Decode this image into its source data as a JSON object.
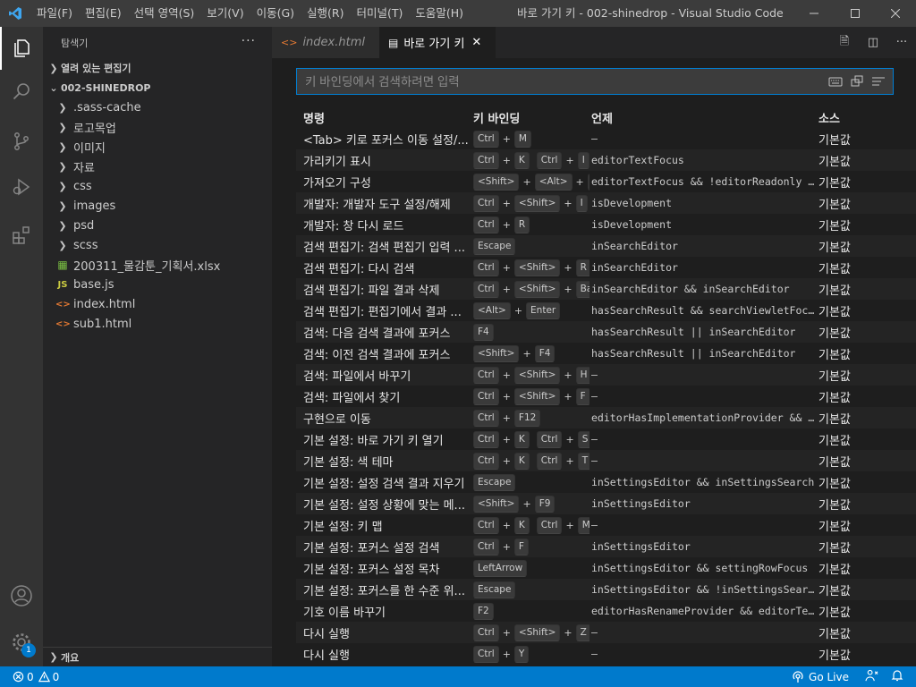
{
  "titlebar": {
    "menu": [
      "파일(F)",
      "편집(E)",
      "선택 영역(S)",
      "보기(V)",
      "이동(G)",
      "실행(R)",
      "터미널(T)",
      "도움말(H)"
    ],
    "window_title": "바로 가기 키 - 002-shinedrop - Visual Studio Code [관리..."
  },
  "colors": {
    "accent": "#007acc",
    "titlebar": "#3c3c3c",
    "sidebar": "#252526",
    "editor": "#1e1e1e"
  },
  "activitybar": {
    "settings_badge": "1"
  },
  "sidebar": {
    "title": "탐색기",
    "open_editors": "열려 있는 편집기",
    "folder": "002-SHINEDROP",
    "items": [
      {
        "label": ".sass-cache",
        "type": "folder"
      },
      {
        "label": "로고목업",
        "type": "folder"
      },
      {
        "label": "이미지",
        "type": "folder"
      },
      {
        "label": "자료",
        "type": "folder"
      },
      {
        "label": "css",
        "type": "folder"
      },
      {
        "label": "images",
        "type": "folder"
      },
      {
        "label": "psd",
        "type": "folder"
      },
      {
        "label": "scss",
        "type": "folder"
      },
      {
        "label": "200311_물감툰_기획서.xlsx",
        "type": "xlsx"
      },
      {
        "label": "base.js",
        "type": "js"
      },
      {
        "label": "index.html",
        "type": "html"
      },
      {
        "label": "sub1.html",
        "type": "html"
      }
    ],
    "outline": "개요"
  },
  "tabs": [
    {
      "label": "index.html",
      "active": false
    },
    {
      "label": "바로 가기 키",
      "active": true
    }
  ],
  "search": {
    "placeholder": "키 바인딩에서 검색하려면 입력"
  },
  "table": {
    "headers": {
      "command": "명령",
      "keybinding": "키 바인딩",
      "when": "언제",
      "source": "소스"
    },
    "rows": [
      {
        "command": "<Tab> 키로 포커스 이동 설정/...",
        "keys": [
          [
            "Ctrl",
            "M"
          ]
        ],
        "when": "—",
        "source": "기본값"
      },
      {
        "command": "가리키기 표시",
        "keys": [
          [
            "Ctrl",
            "K"
          ],
          [
            "Ctrl",
            "I"
          ]
        ],
        "when": "editorTextFocus",
        "source": "기본값"
      },
      {
        "command": "가져오기 구성",
        "keys": [
          [
            "<Shift>",
            "<Alt>",
            "O"
          ]
        ],
        "when": "editorTextFocus && !editorReadonly && ...",
        "source": "기본값"
      },
      {
        "command": "개발자: 개발자 도구 설정/해제",
        "keys": [
          [
            "Ctrl",
            "<Shift>",
            "I"
          ]
        ],
        "when": "isDevelopment",
        "source": "기본값"
      },
      {
        "command": "개발자: 창 다시 로드",
        "keys": [
          [
            "Ctrl",
            "R"
          ]
        ],
        "when": "isDevelopment",
        "source": "기본값"
      },
      {
        "command": "검색 편집기: 검색 편집기 입력 ...",
        "keys": [
          [
            "Escape"
          ]
        ],
        "when": "inSearchEditor",
        "source": "기본값"
      },
      {
        "command": "검색 편집기: 다시 검색",
        "keys": [
          [
            "Ctrl",
            "<Shift>",
            "R"
          ]
        ],
        "when": "inSearchEditor",
        "source": "기본값"
      },
      {
        "command": "검색 편집기: 파일 결과 삭제",
        "keys": [
          [
            "Ctrl",
            "<Shift>",
            "Backspace"
          ]
        ],
        "when": "inSearchEditor && inSearchEditor",
        "source": "기본값"
      },
      {
        "command": "검색 편집기: 편집기에서 결과 ...",
        "keys": [
          [
            "<Alt>",
            "Enter"
          ]
        ],
        "when": "hasSearchResult && searchViewletFocus",
        "source": "기본값"
      },
      {
        "command": "검색: 다음 검색 결과에 포커스",
        "keys": [
          [
            "F4"
          ]
        ],
        "when": "hasSearchResult || inSearchEditor",
        "source": "기본값"
      },
      {
        "command": "검색: 이전 검색 결과에 포커스",
        "keys": [
          [
            "<Shift>",
            "F4"
          ]
        ],
        "when": "hasSearchResult || inSearchEditor",
        "source": "기본값"
      },
      {
        "command": "검색: 파일에서 바꾸기",
        "keys": [
          [
            "Ctrl",
            "<Shift>",
            "H"
          ]
        ],
        "when": "—",
        "source": "기본값"
      },
      {
        "command": "검색: 파일에서 찾기",
        "keys": [
          [
            "Ctrl",
            "<Shift>",
            "F"
          ]
        ],
        "when": "—",
        "source": "기본값"
      },
      {
        "command": "구현으로 이동",
        "keys": [
          [
            "Ctrl",
            "F12"
          ]
        ],
        "when": "editorHasImplementationProvider && edi...",
        "source": "기본값"
      },
      {
        "command": "기본 설정: 바로 가기 키 열기",
        "keys": [
          [
            "Ctrl",
            "K"
          ],
          [
            "Ctrl",
            "S"
          ]
        ],
        "when": "—",
        "source": "기본값"
      },
      {
        "command": "기본 설정: 색 테마",
        "keys": [
          [
            "Ctrl",
            "K"
          ],
          [
            "Ctrl",
            "T"
          ]
        ],
        "when": "—",
        "source": "기본값"
      },
      {
        "command": "기본 설정: 설정 검색 결과 지우기",
        "keys": [
          [
            "Escape"
          ]
        ],
        "when": "inSettingsEditor && inSettingsSearch",
        "source": "기본값"
      },
      {
        "command": "기본 설정: 설정 상황에 맞는 메...",
        "keys": [
          [
            "<Shift>",
            "F9"
          ]
        ],
        "when": "inSettingsEditor",
        "source": "기본값"
      },
      {
        "command": "기본 설정: 키 맵",
        "keys": [
          [
            "Ctrl",
            "K"
          ],
          [
            "Ctrl",
            "M"
          ]
        ],
        "when": "—",
        "source": "기본값"
      },
      {
        "command": "기본 설정: 포커스 설정 검색",
        "keys": [
          [
            "Ctrl",
            "F"
          ]
        ],
        "when": "inSettingsEditor",
        "source": "기본값"
      },
      {
        "command": "기본 설정: 포커스 설정 목차",
        "keys": [
          [
            "LeftArrow"
          ]
        ],
        "when": "inSettingsEditor && settingRowFocus",
        "source": "기본값"
      },
      {
        "command": "기본 설정: 포커스를 한 수준 위...",
        "keys": [
          [
            "Escape"
          ]
        ],
        "when": "inSettingsEditor && !inSettingsSearch",
        "source": "기본값"
      },
      {
        "command": "기호 이름 바꾸기",
        "keys": [
          [
            "F2"
          ]
        ],
        "when": "editorHasRenameProvider && editorTextF...",
        "source": "기본값"
      },
      {
        "command": "다시 실행",
        "keys": [
          [
            "Ctrl",
            "<Shift>",
            "Z"
          ]
        ],
        "when": "—",
        "source": "기본값"
      },
      {
        "command": "다시 실행",
        "keys": [
          [
            "Ctrl",
            "Y"
          ]
        ],
        "when": "—",
        "source": "기본값"
      }
    ]
  },
  "statusbar": {
    "errors": "0",
    "warnings": "0",
    "golive": "Go Live"
  }
}
